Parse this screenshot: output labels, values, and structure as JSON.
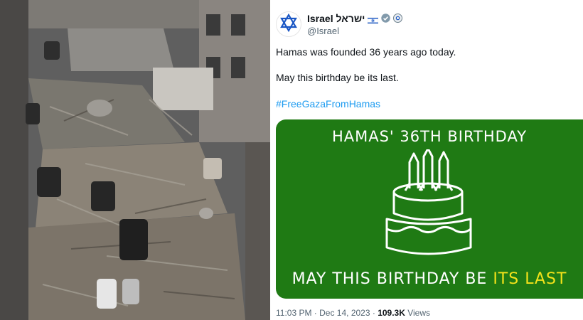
{
  "tweet": {
    "display_name": "Israel ישראל",
    "handle": "@Israel",
    "line1": "Hamas was founded 36 years ago today.",
    "line2": "May this birthday be its last.",
    "hashtag": "#FreeGazaFromHamas",
    "card": {
      "title": "HAMAS' 36TH BIRTHDAY",
      "tagline_prefix": "MAY THIS BIRTHDAY BE ",
      "tagline_accent": "ITS LAST",
      "background_color": "#1f7a14",
      "accent_color": "#f3e21a"
    },
    "timestamp": "11:03 PM · Dec 14, 2023 · ",
    "views_count": "109.3K",
    "views_label": " Views"
  },
  "icons": {
    "avatar": "star-of-david-icon",
    "flag": "israel-flag-icon",
    "verified": "verified-badge-icon",
    "affiliation": "gear-badge-icon"
  },
  "colors": {
    "link": "#1d9bf0",
    "text": "#0f1419",
    "muted": "#536471"
  }
}
